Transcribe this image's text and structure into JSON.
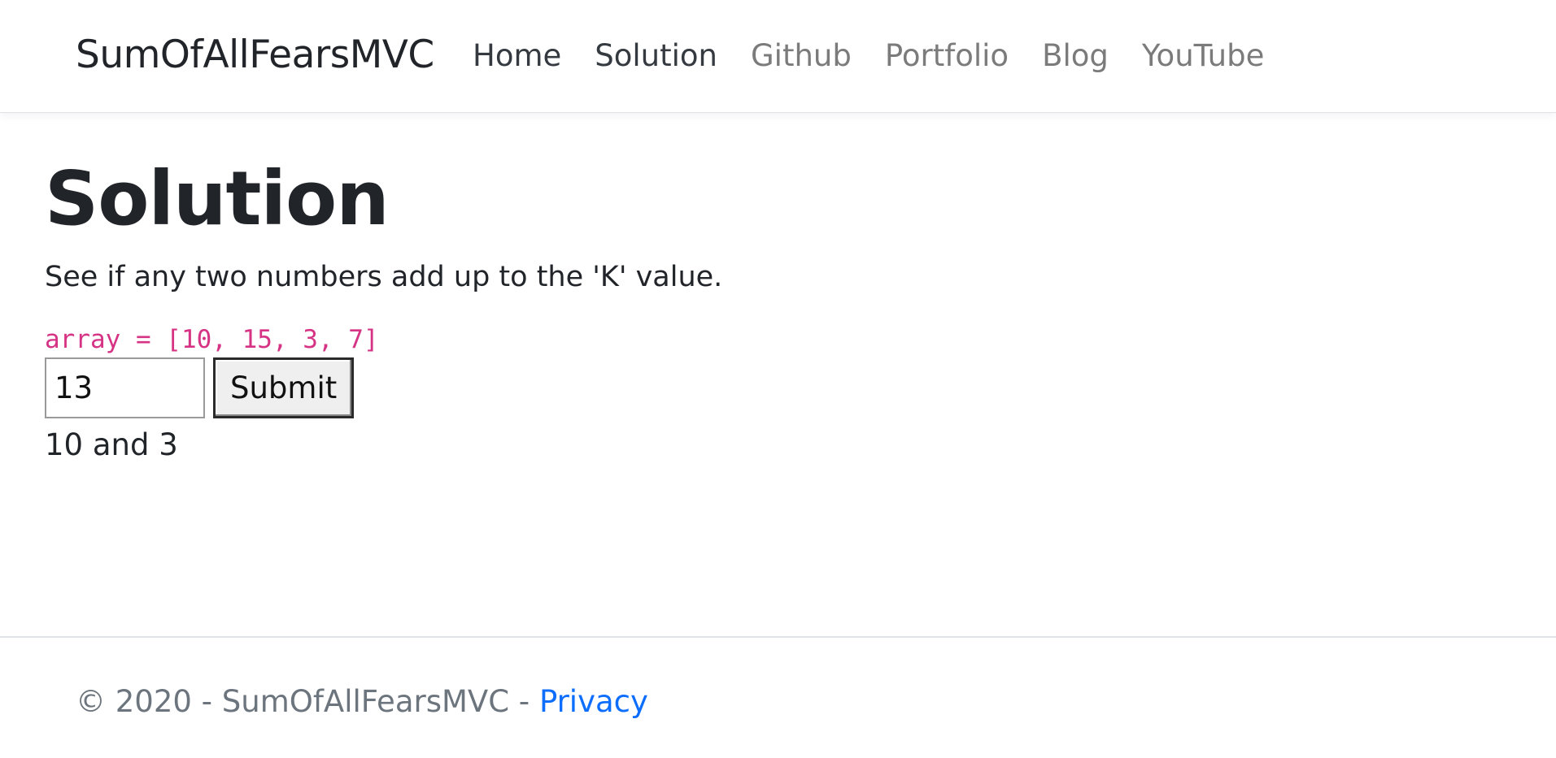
{
  "navbar": {
    "brand": "SumOfAllFearsMVC",
    "items": [
      {
        "label": "Home"
      },
      {
        "label": "Solution"
      },
      {
        "label": "Github"
      },
      {
        "label": "Portfolio"
      },
      {
        "label": "Blog"
      },
      {
        "label": "YouTube"
      }
    ]
  },
  "main": {
    "title": "Solution",
    "description": "See if any two numbers add up to the 'K' value.",
    "code": "array = [10, 15, 3, 7]",
    "input_value": "13",
    "submit_label": "Submit",
    "result": "10 and 3"
  },
  "footer": {
    "prefix": "© 2020 - SumOfAllFearsMVC - ",
    "privacy_label": "Privacy"
  },
  "colors": {
    "code": "#d63384",
    "link": "#0d6efd",
    "muted": "#6c757d"
  }
}
